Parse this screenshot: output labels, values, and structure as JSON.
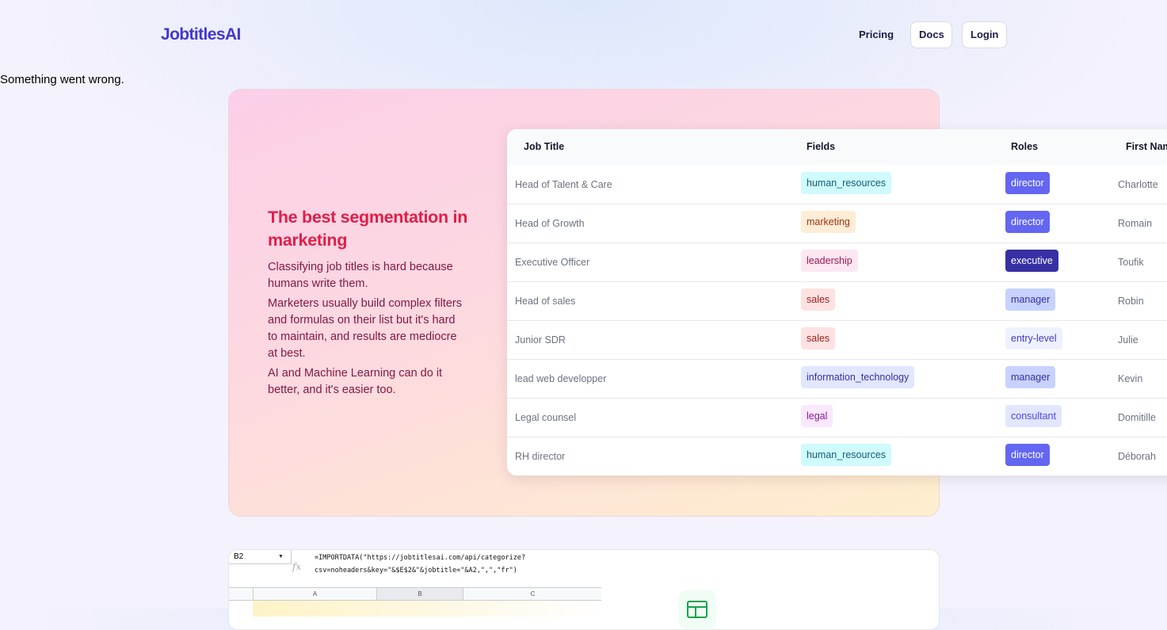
{
  "header": {
    "logo": "JobtitlesAI",
    "nav": {
      "pricing": "Pricing",
      "docs": "Docs",
      "login": "Login"
    }
  },
  "error_message": "Something went wrong.",
  "hero": {
    "title": "The best segmentation in marketing",
    "paragraphs": [
      "Classifying job titles is hard because humans write them.",
      "Marketers usually build complex filters and formulas on their list but it's hard to maintain, and results are mediocre at best.",
      "AI and Machine Learning can do it better, and it's easier too."
    ]
  },
  "table": {
    "headers": [
      "Job Title",
      "Fields",
      "Roles",
      "First Nam"
    ],
    "rows": [
      {
        "job_title": "Head of Talent & Care",
        "field": "human_resources",
        "role": "director",
        "first_name": "Charlotte"
      },
      {
        "job_title": "Head of Growth",
        "field": "marketing",
        "role": "director",
        "first_name": "Romain"
      },
      {
        "job_title": "Executive Officer",
        "field": "leadership",
        "role": "executive",
        "first_name": "Toufik"
      },
      {
        "job_title": "Head of sales",
        "field": "sales",
        "role": "manager",
        "first_name": "Robin"
      },
      {
        "job_title": "Junior SDR",
        "field": "sales",
        "role": "entry-level",
        "first_name": "Julie"
      },
      {
        "job_title": "lead web developper",
        "field": "information_technology",
        "role": "manager",
        "first_name": "Kevin"
      },
      {
        "job_title": "Legal counsel",
        "field": "legal",
        "role": "consultant",
        "first_name": "Domitille"
      },
      {
        "job_title": "RH director",
        "field": "human_resources",
        "role": "director",
        "first_name": "Déborah"
      }
    ]
  },
  "colors": {
    "brand": "#4338ca",
    "hero_title": "#e11d48",
    "hero_text": "#831843",
    "fields": {
      "human_resources": {
        "bg": "#cffafe",
        "fg": "#155e75"
      },
      "marketing": {
        "bg": "#ffedd5",
        "fg": "#9a3412"
      },
      "leadership": {
        "bg": "#fce7f3",
        "fg": "#9d174d"
      },
      "sales": {
        "bg": "#fee2e2",
        "fg": "#991b1b"
      },
      "information_technology": {
        "bg": "#e0e7ff",
        "fg": "#3730a3"
      },
      "legal": {
        "bg": "#fae8ff",
        "fg": "#86198f"
      }
    },
    "roles": {
      "director": {
        "bg": "#6366f1",
        "fg": "#ffffff"
      },
      "executive": {
        "bg": "#3730a3",
        "fg": "#ffffff"
      },
      "manager": {
        "bg": "#c7d2fe",
        "fg": "#3730a3"
      },
      "entry-level": {
        "bg": "#eef2ff",
        "fg": "#4338ca"
      },
      "consultant": {
        "bg": "#e0e7ff",
        "fg": "#4f46e5"
      }
    }
  },
  "spreadsheet": {
    "cell_ref": "B2",
    "formula_line1": "=IMPORTDATA(\"https://jobtitlesai.com/api/categorize?",
    "formula_line2": "csv=noheaders&key=\"&$E$2&\"&jobtitle=\"&A2,\",\",\"fr\")",
    "columns": [
      "A",
      "B",
      "C"
    ],
    "icon": "google-sheets-icon"
  }
}
